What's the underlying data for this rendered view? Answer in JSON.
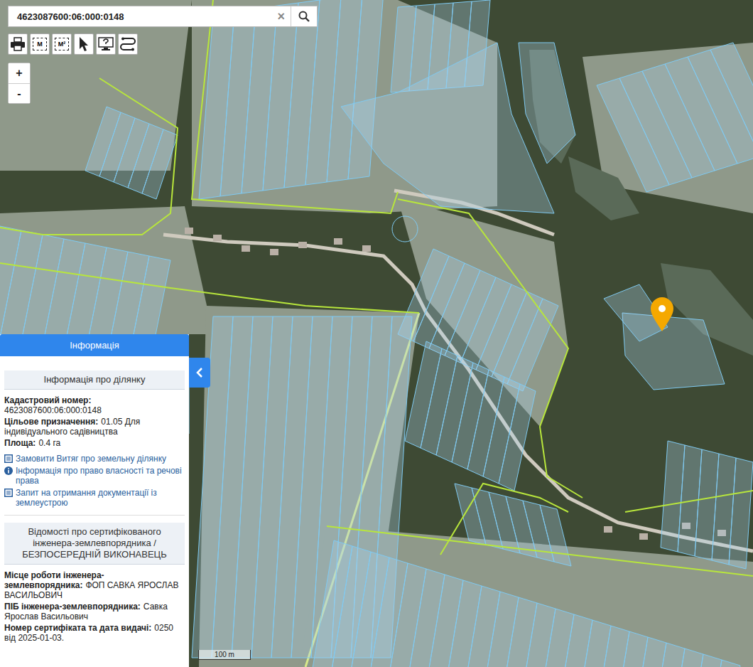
{
  "search": {
    "value": "4623087600:06:000:0148",
    "clear": "×"
  },
  "toolbar": [
    {
      "kind": "print"
    },
    {
      "kind": "length",
      "label": "M"
    },
    {
      "kind": "area",
      "label": "M²"
    },
    {
      "kind": "select"
    },
    {
      "kind": "help"
    },
    {
      "kind": "route"
    }
  ],
  "zoom": [
    "+",
    "-"
  ],
  "panel": {
    "title": "Інформація",
    "parcel": {
      "heading": "Інформація про ділянку",
      "fields": [
        {
          "kind": "stacked",
          "label": "Кадастровий номер:",
          "value": "4623087600:06:000:0148"
        },
        {
          "kind": "inline",
          "label": "Цільове призначення:",
          "value": "01.05 Для індивідуального садівництва"
        },
        {
          "kind": "inline",
          "label": "Площа:",
          "value": "0.4 га"
        }
      ],
      "links": [
        {
          "kind": "document",
          "text": "Замовити Витяг про земельну ділянку"
        },
        {
          "kind": "info",
          "text": "Інформація про право власності та речові права"
        },
        {
          "kind": "document",
          "text": "Запит на отримання документації із землеустрою"
        }
      ]
    },
    "engineer": {
      "heading": "Відомості про сертифікованого інженера-землевпорядника / БЕЗПОСЕРЕДНІЙ ВИКОНАВЕЦЬ",
      "fields": [
        {
          "kind": "inline",
          "label": "Місце роботи інженера-землевпорядника:",
          "value": "ФОП САВКА ЯРОСЛАВ ВАСИЛЬОВИЧ"
        },
        {
          "kind": "inline",
          "label": "ПІБ інженера-землевпорядника:",
          "value": "Савка Ярослав Васильович"
        },
        {
          "kind": "inline",
          "label": "Номер сертифіката та дата видачі:",
          "value": "0250 від 2025-01-03."
        }
      ]
    }
  },
  "scale": "100 m"
}
